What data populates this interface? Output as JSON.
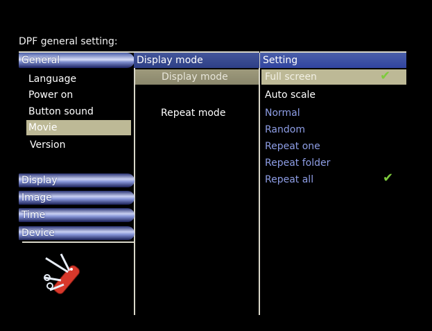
{
  "title": "DPF general setting:",
  "left": {
    "header": "General",
    "items": [
      "Language",
      "Power on",
      "Button sound",
      "Movie",
      "Version"
    ],
    "categories": [
      "Display",
      "Image",
      "Time",
      "Device"
    ]
  },
  "middle": {
    "header": "Display mode",
    "items": [
      "Display mode",
      "Repeat mode"
    ]
  },
  "right": {
    "header": "Setting",
    "display_options": [
      "Full screen",
      "Auto scale"
    ],
    "repeat_options": [
      "Normal",
      "Random",
      "Repeat one",
      "Repeat folder",
      "Repeat all"
    ]
  },
  "icons": {
    "check": "checkmark-icon",
    "tool": "swiss-knife-icon"
  },
  "colors": {
    "selection": "#bdb996",
    "header_blue": "#3144a0",
    "option_blue": "#8e9ee6",
    "check_green": "#7ecb3d"
  }
}
